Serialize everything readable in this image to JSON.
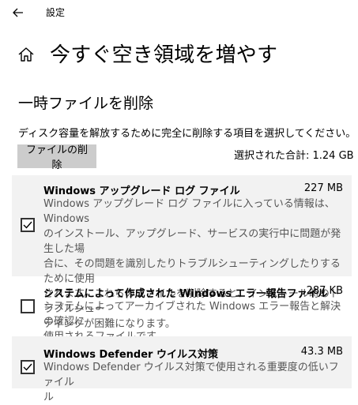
{
  "window": {
    "title": "設定"
  },
  "page": {
    "title": "今すぐ空き領域を増やす"
  },
  "section": {
    "title": "一時ファイルを削除"
  },
  "description": "ディスク容量を解放するために完全に削除する項目を選択してください。",
  "delete_button": {
    "label": "ファイルの削除"
  },
  "total": {
    "label": "選択された合計: 1.24 GB"
  },
  "items": [
    {
      "name": "Windows アップグレード ログ ファイル",
      "size": "227 MB",
      "checked": true,
      "lines": [
        "Windows アップグレード ログ ファイルに入っている情報は、Windows",
        "のインストール、アップグレード、サービスの実行中に問題が発生した場",
        "合に、その問題を識別したりトラブルシューティングしたりするために使用",
        "されます。これらのファイルを削除すると、インストール時のトラブルシュー",
        "ティングが困難になります。"
      ]
    },
    {
      "name": "システムによって作成された Windows エラー報告ファイル",
      "size": "287 KB",
      "checked": false,
      "lines": [
        "システムによってアーカイブされた Windows エラー報告と解決の確認に",
        "使用されるファイルです。"
      ]
    },
    {
      "name": "Windows Defender ウイルス対策",
      "size": "43.3 MB",
      "checked": true,
      "lines": [
        "Windows Defender ウイルス対策で使用される重要度の低いファイル",
        "ル"
      ]
    }
  ]
}
